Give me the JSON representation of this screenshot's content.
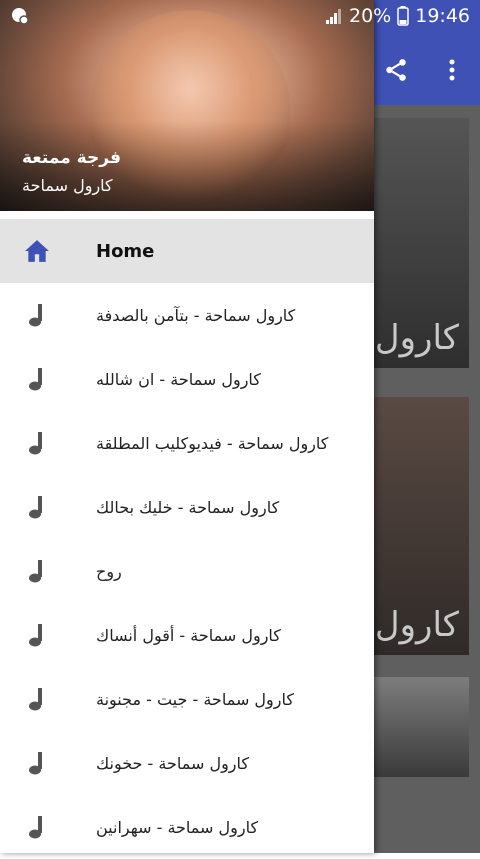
{
  "status_bar": {
    "battery": "20%",
    "time": "19:46"
  },
  "drawer": {
    "header": {
      "title": "فرجة ممتعة",
      "subtitle": "كارول سماحة"
    },
    "items": [
      {
        "label": "Home",
        "icon": "home-icon",
        "active": true
      },
      {
        "label": "كارول سماحة - بتآمن بالصدفة",
        "icon": "music-note-icon"
      },
      {
        "label": "كارول سماحة - ان شالله",
        "icon": "music-note-icon"
      },
      {
        "label": "كارول سماحة - فيديوكليب المطلقة",
        "icon": "music-note-icon"
      },
      {
        "label": "كارول سماحة - خليك بحالك",
        "icon": "music-note-icon"
      },
      {
        "label": "روح",
        "icon": "music-note-icon"
      },
      {
        "label": "كارول سماحة - أقول أنساك",
        "icon": "music-note-icon"
      },
      {
        "label": "كارول سماحة - جيت - مجنونة",
        "icon": "music-note-icon"
      },
      {
        "label": "كارول سماحة - حخونك",
        "icon": "music-note-icon"
      },
      {
        "label": "كارول سماحة - سهرانين",
        "icon": "music-note-icon"
      }
    ]
  },
  "background": {
    "cards": [
      {
        "text": "كارول"
      },
      {
        "text": "كارول"
      }
    ]
  },
  "colors": {
    "toolbar": "#3f51b5",
    "home_icon": "#3f51b5",
    "note_icon": "#555555"
  }
}
